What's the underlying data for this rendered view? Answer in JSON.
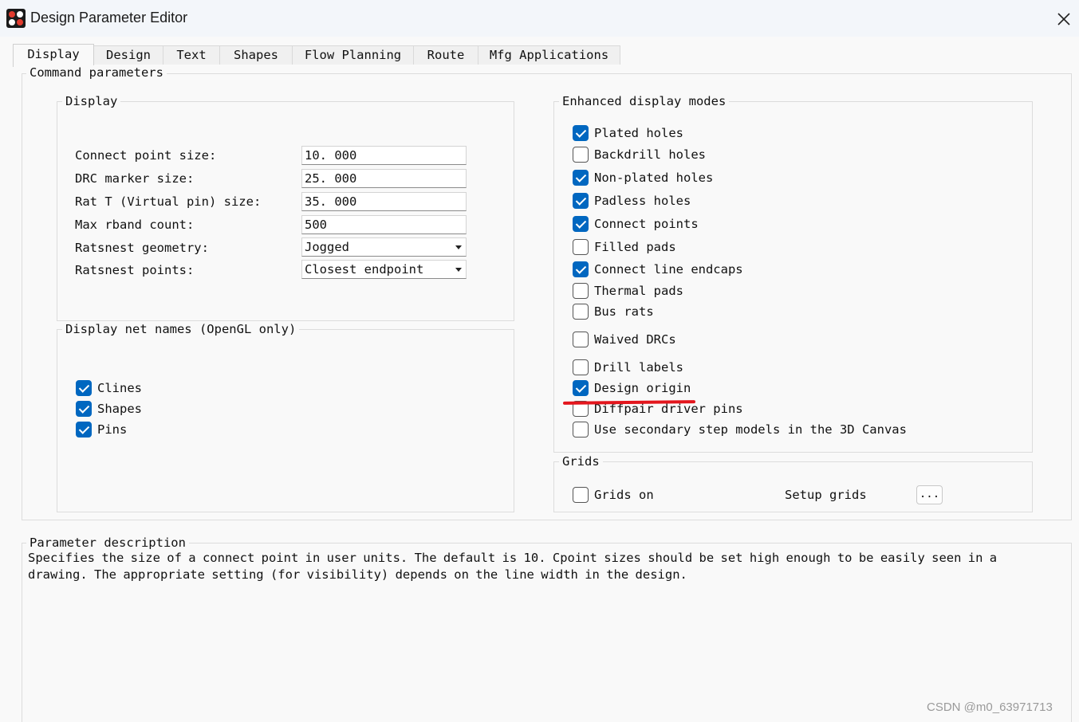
{
  "window": {
    "title": "Design Parameter Editor",
    "close_glyph": "✕"
  },
  "tabs": [
    {
      "label": "Display",
      "active": true
    },
    {
      "label": "Design"
    },
    {
      "label": "Text"
    },
    {
      "label": "Shapes"
    },
    {
      "label": "Flow Planning"
    },
    {
      "label": "Route"
    },
    {
      "label": "Mfg Applications"
    }
  ],
  "command_parameters": {
    "legend": "Command parameters",
    "display": {
      "legend": "Display",
      "rows": [
        {
          "label": "Connect point size:",
          "value": "10. 000"
        },
        {
          "label": "DRC marker size:",
          "value": "25. 000"
        },
        {
          "label": "Rat T (Virtual pin) size:",
          "value": "35. 000"
        },
        {
          "label": "Max rband count:",
          "value": "500"
        },
        {
          "label": "Ratsnest geometry:",
          "value": "Jogged"
        },
        {
          "label": "Ratsnest points:",
          "value": "Closest endpoint"
        }
      ]
    },
    "net_names": {
      "legend": "Display net names (OpenGL only)",
      "items": [
        {
          "label": "Clines",
          "checked": true
        },
        {
          "label": "Shapes",
          "checked": true
        },
        {
          "label": "Pins",
          "checked": true
        }
      ]
    },
    "enhanced": {
      "legend": "Enhanced display modes",
      "items": [
        {
          "label": "Plated holes",
          "checked": true
        },
        {
          "label": "Backdrill holes",
          "checked": false
        },
        {
          "label": "Non-plated holes",
          "checked": true
        },
        {
          "label": "Padless holes",
          "checked": true
        },
        {
          "label": "Connect points",
          "checked": true
        },
        {
          "label": "Filled pads",
          "checked": false
        },
        {
          "label": "Connect line endcaps",
          "checked": true
        },
        {
          "label": "Thermal pads",
          "checked": false
        },
        {
          "label": "Bus rats",
          "checked": false
        },
        {
          "label": "Waived DRCs",
          "checked": false
        },
        {
          "label": "Drill labels",
          "checked": false
        },
        {
          "label": "Design origin",
          "checked": true
        },
        {
          "label": "Diffpair driver pins",
          "checked": false
        },
        {
          "label": "Use secondary step models in the 3D Canvas",
          "checked": false
        }
      ]
    },
    "grids": {
      "legend": "Grids",
      "grids_on_label": "Grids on",
      "grids_on_checked": false,
      "setup_label": "Setup grids",
      "setup_button": "..."
    }
  },
  "description": {
    "legend": "Parameter description",
    "text": "Specifies the size of a connect point in user units. The default is 10. Cpoint sizes should be set high enough to be easily seen in a drawing. The appropriate setting (for visibility) depends on the line width in the design."
  },
  "watermark": "CSDN @m0_63971713",
  "colors": {
    "accent": "#0067c0",
    "annotation_red": "#e3161d"
  }
}
